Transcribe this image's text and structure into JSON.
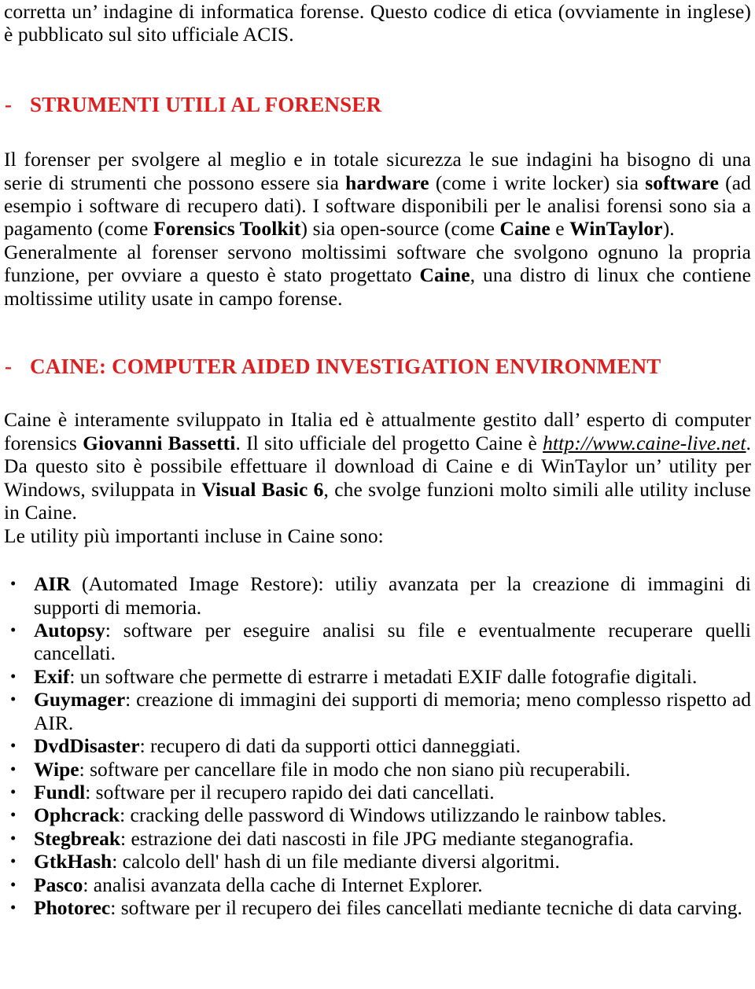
{
  "document": {
    "intro_paragraph": {
      "text": "corretta un’ indagine di informatica forense. Questo codice di etica (ovviamente in inglese) è pubblicato sul sito ufficiale ACIS."
    },
    "heading_1": {
      "dash": "-",
      "text": "STRUMENTI UTILI AL FORENSER",
      "color": "#DD1F1F"
    },
    "paragraph_1": {
      "seg_1": "Il forenser per svolgere al meglio e in totale sicurezza le sue indagini ha bisogno di una serie di strumenti che possono essere sia ",
      "bold_1": "hardware",
      "seg_2": " (come i write locker) sia ",
      "bold_2": "software",
      "seg_3": " (ad esempio i software di recupero dati). I software disponibili per le analisi forensi sono sia a pagamento (come ",
      "bold_3": "Forensics Toolkit",
      "seg_4": ") sia open-source (come ",
      "bold_4": "Caine",
      "seg_5": " e ",
      "bold_5": "WinTaylor",
      "seg_6": ")."
    },
    "paragraph_2": {
      "seg_1": "Generalmente al forenser servono moltissimi software che svolgono ognuno la propria funzione, per ovviare a questo è stato progettato ",
      "bold_1": "Caine",
      "seg_2": ", una distro di linux che contiene moltissime utility usate in campo forense."
    },
    "heading_2": {
      "dash": "-",
      "text": "CAINE: COMPUTER AIDED INVESTIGATION ENVIRONMENT",
      "color": "#DD1F1F"
    },
    "paragraph_3": {
      "seg_1": "Caine è interamente sviluppato in Italia ed è attualmente gestito dall’ esperto di computer forensics ",
      "bold_1": "Giovanni Bassetti",
      "seg_2": ". Il sito ufficiale del progetto Caine è ",
      "link": "http://www.caine-live.net",
      "seg_3": ". Da questo sito è possibile effettuare il download di Caine e di WinTaylor un’ utility per Windows, sviluppata in ",
      "bold_2": "Visual Basic 6",
      "seg_4": ", che svolge funzioni molto simili alle utility incluse in Caine."
    },
    "paragraph_4": {
      "text": "Le utility più importanti incluse in Caine sono:"
    },
    "bullet_glyph": "•",
    "utilities": [
      {
        "name": "AIR",
        "desc": " (Automated Image Restore): utiliy avanzata per la creazione di immagini di supporti di memoria."
      },
      {
        "name": "Autopsy",
        "desc": ": software per eseguire analisi su file e eventualmente recuperare quelli cancellati."
      },
      {
        "name": "Exif",
        "desc": ": un software che permette di estrarre i metadati EXIF dalle fotografie digitali."
      },
      {
        "name": "Guymager",
        "desc": ": creazione di immagini dei supporti di memoria; meno complesso rispetto ad AIR."
      },
      {
        "name": "DvdDisaster",
        "desc": ": recupero di dati da supporti ottici danneggiati."
      },
      {
        "name": "Wipe",
        "desc": ": software per cancellare file in modo che non siano più recuperabili."
      },
      {
        "name": "Fundl",
        "desc": ": software per il recupero rapido dei dati cancellati."
      },
      {
        "name": "Ophcrack",
        "desc": ": cracking delle password di Windows utilizzando le rainbow tables."
      },
      {
        "name": "Stegbreak",
        "desc": ": estrazione dei dati nascosti in file JPG mediante steganografia."
      },
      {
        "name": "GtkHash",
        "desc": ": calcolo dell' hash di un file mediante diversi algoritmi."
      },
      {
        "name": "Pasco",
        "desc": ": analisi avanzata della cache di Internet Explorer."
      },
      {
        "name": "Photorec",
        "desc": ": software per il recupero dei files cancellati mediante tecniche di data carving."
      }
    ]
  }
}
